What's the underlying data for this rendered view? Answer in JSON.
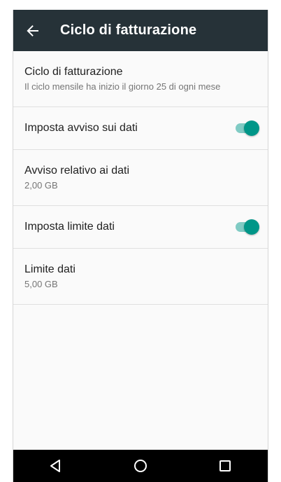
{
  "appbar": {
    "title": "Ciclo di fatturazione",
    "back_icon": "arrow-back-icon"
  },
  "settings": [
    {
      "title": "Ciclo di fatturazione",
      "subtitle": "Il ciclo mensile ha inizio il giorno 25 di ogni mese"
    },
    {
      "title": "Imposta avviso sui dati",
      "switch_on": true
    },
    {
      "title": "Avviso relativo ai dati",
      "subtitle": "2,00 GB"
    },
    {
      "title": "Imposta limite dati",
      "switch_on": true
    },
    {
      "title": "Limite dati",
      "subtitle": "5,00 GB"
    }
  ],
  "navbar": {
    "icons": [
      "back-triangle-icon",
      "home-circle-icon",
      "recents-square-icon"
    ]
  },
  "colors": {
    "appbar": "#263238",
    "accent": "#009688",
    "accent_track": "#80cbc4"
  }
}
